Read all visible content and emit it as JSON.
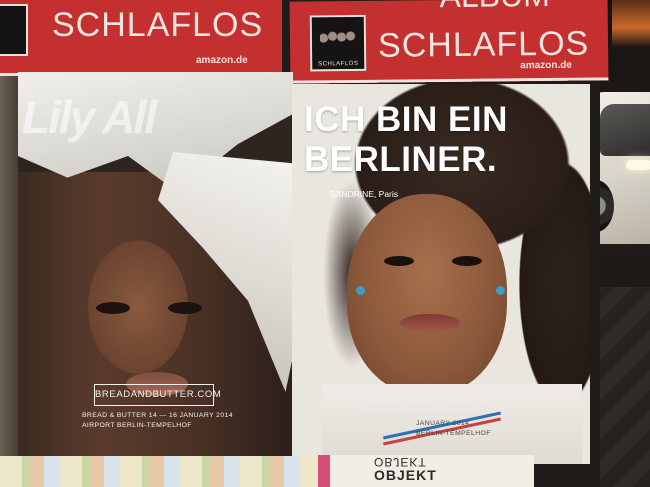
{
  "scene": {
    "description_colors": {
      "banner_red": "#c3302f",
      "earring_blue": "#3f9dc4"
    }
  },
  "banners": {
    "left": {
      "title": "SCHLAFLOS",
      "store": "amazon.de"
    },
    "right": {
      "top_text": "ALBUM",
      "title": "SCHLAFLOS",
      "thumb_label": "SCHLAFLOS",
      "store": "amazon.de"
    }
  },
  "poster_left": {
    "brand": "BREADANDBUTTER.COM",
    "event_line_1": "BREAD & BUTTER 14 — 16 JANUARY 2014",
    "event_line_2": "AIRPORT BERLIN-TEMPELHOF"
  },
  "poster_right": {
    "headline_1": "ICH BIN EIN",
    "headline_2": "BERLINER.",
    "caption": "SANDRINE, Paris",
    "brand": "BREADANDBUTTER.COM",
    "event_line_1": "JANUARY 2014",
    "event_line_2": "BERLIN-TEMPELHOF"
  },
  "bottom": {
    "line_1": "OBJEKT",
    "line_2": "OBJEKT"
  }
}
